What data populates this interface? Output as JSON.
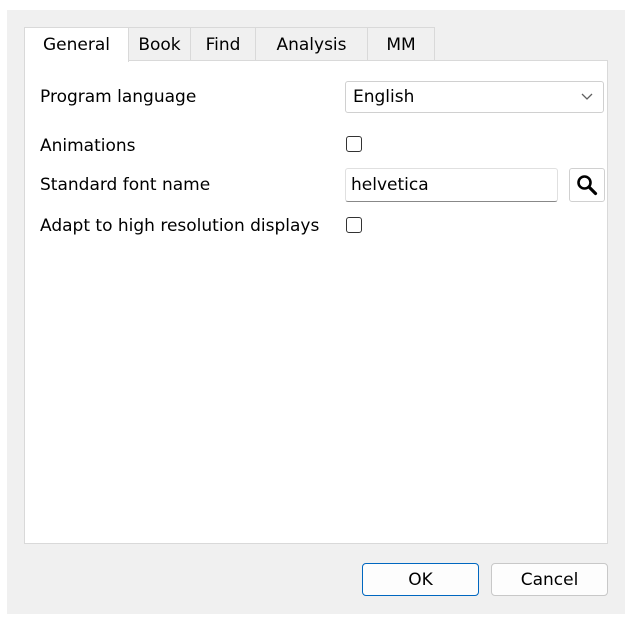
{
  "tabs": [
    {
      "label": "General",
      "active": true
    },
    {
      "label": "Book",
      "active": false
    },
    {
      "label": "Find",
      "active": false
    },
    {
      "label": "Analysis",
      "active": false
    },
    {
      "label": "MM",
      "active": false
    }
  ],
  "settings": {
    "program_language": {
      "label": "Program language",
      "selected": "English"
    },
    "animations": {
      "label": "Animations",
      "checked": false
    },
    "standard_font": {
      "label": "Standard font name",
      "value": "helvetica"
    },
    "high_resolution": {
      "label": "Adapt to high resolution displays",
      "checked": false
    }
  },
  "buttons": {
    "ok": "OK",
    "cancel": "Cancel"
  },
  "icons": {
    "dropdown": "chevron-down-icon",
    "font_search": "search-icon"
  },
  "colors": {
    "dialog_background": "#f0f0f0",
    "panel_background": "#ffffff",
    "ok_border": "#0067c0"
  }
}
